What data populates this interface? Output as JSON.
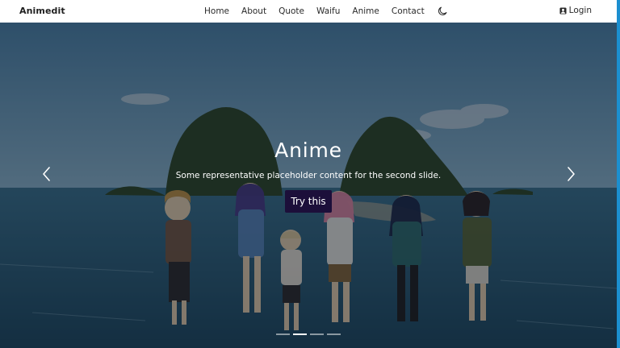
{
  "brand": "Animedit",
  "nav": {
    "links": [
      "Home",
      "About",
      "Quote",
      "Waifu",
      "Anime",
      "Contact"
    ],
    "theme_icon": "moon-icon",
    "login_label": "Login",
    "login_icon": "user-badge-icon"
  },
  "carousel": {
    "title": "Anime",
    "text": "Some representative placeholder content for the second slide.",
    "button_label": "Try this",
    "indicator_count": 4,
    "active_index": 1,
    "prev_icon": "chevron-left-icon",
    "next_icon": "chevron-right-icon"
  },
  "colors": {
    "navbar_bg": "#ffffff",
    "button_bg": "#1c0f3a",
    "scrollbar": "#1b8fd0",
    "sky": "#6fa6c8",
    "sea": "#2d6480"
  }
}
